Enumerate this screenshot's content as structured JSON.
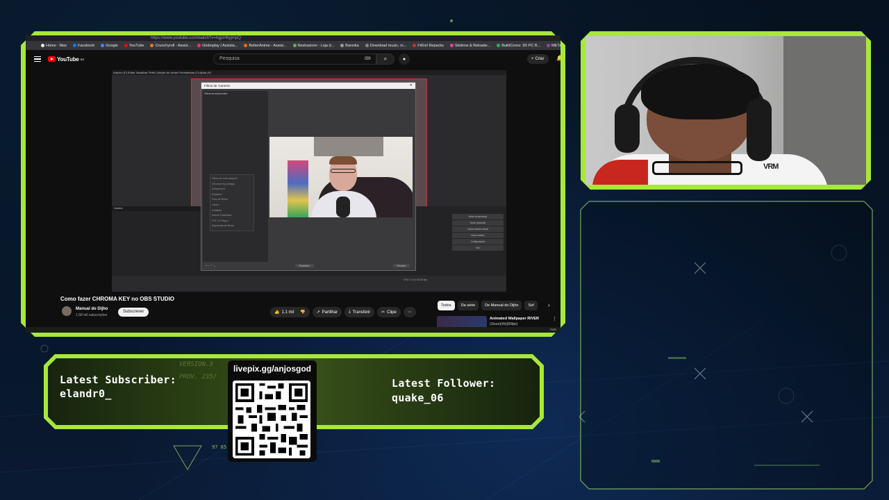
{
  "browser": {
    "url": "https://www.youtube.com/watch?v=hgjcHbyjmpQ",
    "bookmarks": [
      "Home - Max",
      "Facebook",
      "Google",
      "YouTube",
      "Crunchyroll - Assist...",
      "Globoplay | Assista...",
      "BetterAnime - Assist...",
      "Neshastore - Loja d...",
      "Banxika",
      "Download music, m...",
      "FitGirl Repacks",
      "Skidrow & Reloade...",
      "BuildCores: 3D PC B...",
      "META do WARZO..."
    ]
  },
  "youtube": {
    "logo": "YouTube",
    "logo_sup": "BR",
    "search_placeholder": "Pesquisa",
    "create_label": "Criar",
    "video_title": "Como fazer CHROMA KEY no OBS STUDIO",
    "channel_name": "Manual do Dijho",
    "subscribers": "1,58 mil subscrições",
    "subscribe_label": "Subscrever",
    "likes": "1,1 mil",
    "share_label": "Partilhar",
    "download_label": "Transferir",
    "clip_label": "Clipe",
    "chips": [
      "Todos",
      "Da série",
      "De Manual do Dijho",
      "Sof"
    ],
    "recommendation_title": "Animated Wallpaper RIVER",
    "recommendation_sub": "(1hour)(4k)(60fps)",
    "taskbar_lang": "POR"
  },
  "obs": {
    "menubar": "Arquivo (F)   Editar   Visualizar   Perfil   Coleção de cenas   Ferramentas (T)   Ajuda (H)",
    "dialog_title": "Filtros de 'Camera'",
    "effects_label": "Filtros de áudio/vídeo",
    "context_items": [
      "Filtros de vídeo (Async)",
      "Chroma Key (Antiga)",
      "Compressor",
      "Expansor",
      "Filtro de Ruído",
      "Ganho",
      "Limitador",
      "Invertir Polaridade",
      "VST 2.x Plug-in",
      "Supressão de Ruído"
    ],
    "close_label": "Fechar",
    "defaults_label": "Padrões",
    "scene_header": "Camera",
    "controls": [
      "Iniciar transmissão",
      "Iniciar gravação",
      "Iniciar câmera virtual",
      "Modo estúdio",
      "Configurações",
      "Sair"
    ],
    "status": "CPU: 3.1%, 60.00 fps"
  },
  "overlay": {
    "latest_subscriber_label": "Latest Subscriber:",
    "latest_subscriber": "elandr0_",
    "latest_follower_label": "Latest Follower:",
    "latest_follower": "quake_06",
    "qr_label": "livepix.gg/anjosgod",
    "deco_version": "VERSION.3",
    "deco_prov": "PROV. 235/",
    "deco_num": "97 85",
    "accent": "#a7e83a"
  }
}
